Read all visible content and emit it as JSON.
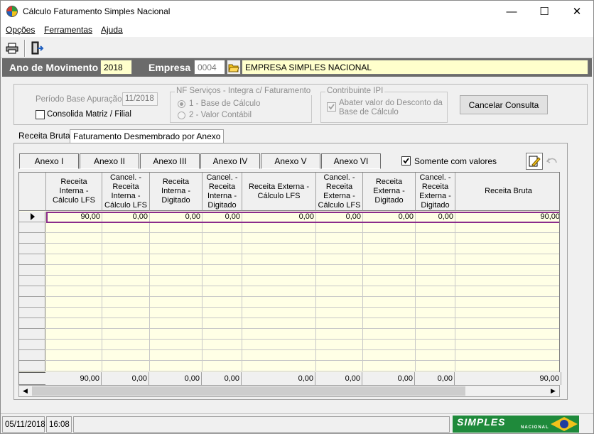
{
  "window": {
    "title": "Cálculo Faturamento Simples Nacional",
    "minimize_glyph": "—",
    "maximize_glyph": "☐",
    "close_glyph": "✕"
  },
  "menu": [
    "Opções",
    "Ferramentas",
    "Ajuda"
  ],
  "toolbar": {
    "print_icon": "printer-icon",
    "exit_icon": "exit-door-icon"
  },
  "header": {
    "ano_label": "Ano de Movimento",
    "ano_value": "2018",
    "empresa_label": "Empresa",
    "empresa_code": "0004",
    "empresa_name": "EMPRESA SIMPLES NACIONAL"
  },
  "filters": {
    "periodo_label": "Período Base Apuração:",
    "periodo_value": "11/2018",
    "consolida_label": "Consolida Matriz / Filial",
    "nf_group_title": "NF Serviços - Integra c/ Faturamento",
    "nf_option1": "1 - Base de Cálculo",
    "nf_option2": "2 - Valor Contábil",
    "ipi_group_title": "Contribuinte IPI",
    "ipi_option": "Abater valor do Desconto da Base de Cálculo",
    "cancel_button": "Cancelar Consulta"
  },
  "tabs": [
    "Receita Bruta",
    "Faturamento Desmembrado por Anexo"
  ],
  "anexos": [
    "Anexo I",
    "Anexo II",
    "Anexo III",
    "Anexo IV",
    "Anexo V",
    "Anexo VI"
  ],
  "somente_label": "Somente com valores",
  "grid": {
    "columns": [
      "Receita Interna - Cálculo LFS",
      "Cancel. - Receita Interna - Cálculo LFS",
      "Receita Interna - Digitado",
      "Cancel. - Receita Interna - Digitado",
      "Receita Externa - Cálculo LFS",
      "Cancel. - Receita Externa - Cálculo LFS",
      "Receita Externa - Digitado",
      "Cancel. - Receita Externa - Digitado",
      "Receita Bruta"
    ],
    "row": [
      "90,00",
      "0,00",
      "0,00",
      "0,00",
      "0,00",
      "0,00",
      "0,00",
      "0,00",
      "90,00"
    ],
    "totals": [
      "90,00",
      "0,00",
      "0,00",
      "0,00",
      "0,00",
      "0,00",
      "0,00",
      "0,00",
      "90,00"
    ]
  },
  "status": {
    "date": "05/11/2018",
    "time": "16:08",
    "logo_text": "SIMPLES",
    "logo_sub": "NACIONAL"
  },
  "colors": {
    "highlight": "#8b2c8b",
    "grid_bg": "#ffffe6",
    "header_band": "#6b6b6b"
  }
}
